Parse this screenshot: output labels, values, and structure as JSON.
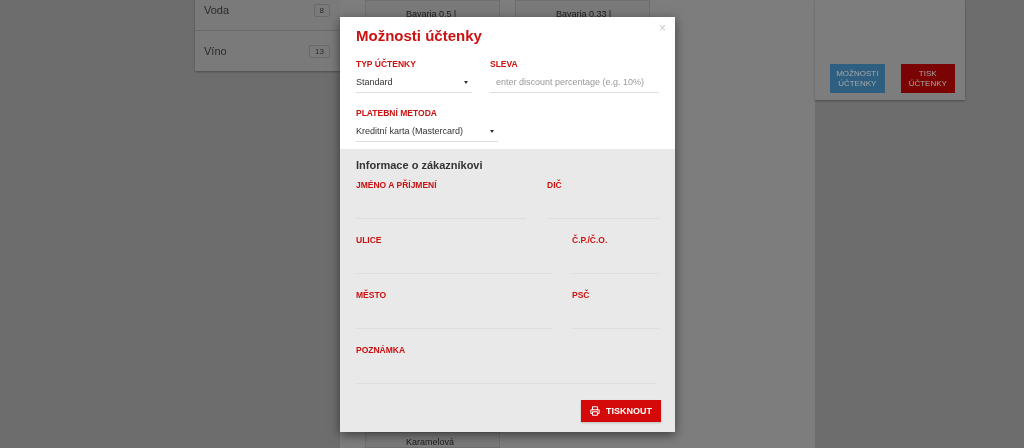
{
  "background": {
    "sidebar": [
      {
        "label": "Voda",
        "count": "8"
      },
      {
        "label": "Víno",
        "count": "13"
      }
    ],
    "products_top": [
      "Bavaria 0,5 l",
      "Bavaria 0,33 l"
    ],
    "products_bottom": [
      "Karamelová"
    ],
    "buttons": [
      {
        "label": "MOŽNOSTI ÚČTENKY",
        "kind": "primary"
      },
      {
        "label": "TISK ÚČTENKY",
        "kind": "danger"
      }
    ]
  },
  "modal": {
    "title": "Možnosti účtenky",
    "close": "×",
    "receipt_type": {
      "label": "TYP ÚČTENKY",
      "value": "Standard"
    },
    "discount": {
      "label": "SLEVA",
      "placeholder": "enter discount percentage (e.g. 10%)"
    },
    "payment": {
      "label": "PLATEBNÍ METODA",
      "value": "Kreditní karta (Mastercard)"
    },
    "customer": {
      "title": "Informace o zákazníkovi",
      "rows": [
        [
          {
            "label": "JMÉNO A PŘÍJMENÍ"
          },
          {
            "label": "DIČ"
          }
        ],
        [
          {
            "label": "ULICE"
          },
          {
            "label": "Č.P./Č.O."
          }
        ],
        [
          {
            "label": "MĚSTO"
          },
          {
            "label": "PSČ"
          }
        ],
        [
          {
            "label": "POZNÁMKA"
          }
        ]
      ]
    },
    "submit": "TISKNOUT"
  }
}
